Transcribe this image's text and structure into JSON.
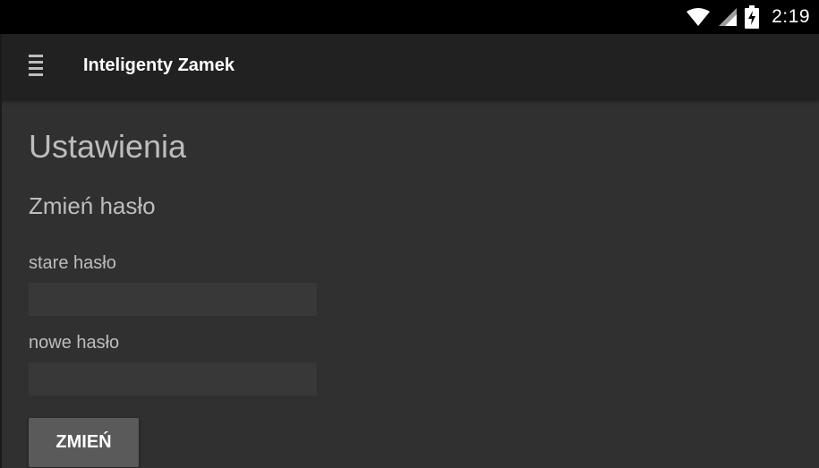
{
  "status_bar": {
    "time": "2:19",
    "icons": [
      "wifi-icon",
      "cell-signal-icon",
      "battery-charging-icon"
    ]
  },
  "app_bar": {
    "menu_icon": "hamburger-menu-icon",
    "title": "Inteligenty Zamek"
  },
  "main": {
    "page_title": "Ustawienia",
    "section_title": "Zmień hasło",
    "old_password": {
      "label": "stare hasło",
      "value": ""
    },
    "new_password": {
      "label": "nowe hasło",
      "value": ""
    },
    "submit_label": "ZMIEŃ"
  },
  "colors": {
    "status_bar_bg": "#000000",
    "app_bar_bg": "#212121",
    "content_bg": "#303030",
    "input_bg": "#383838",
    "button_bg": "#5a5a5a",
    "text_secondary": "#bdbdbd"
  }
}
